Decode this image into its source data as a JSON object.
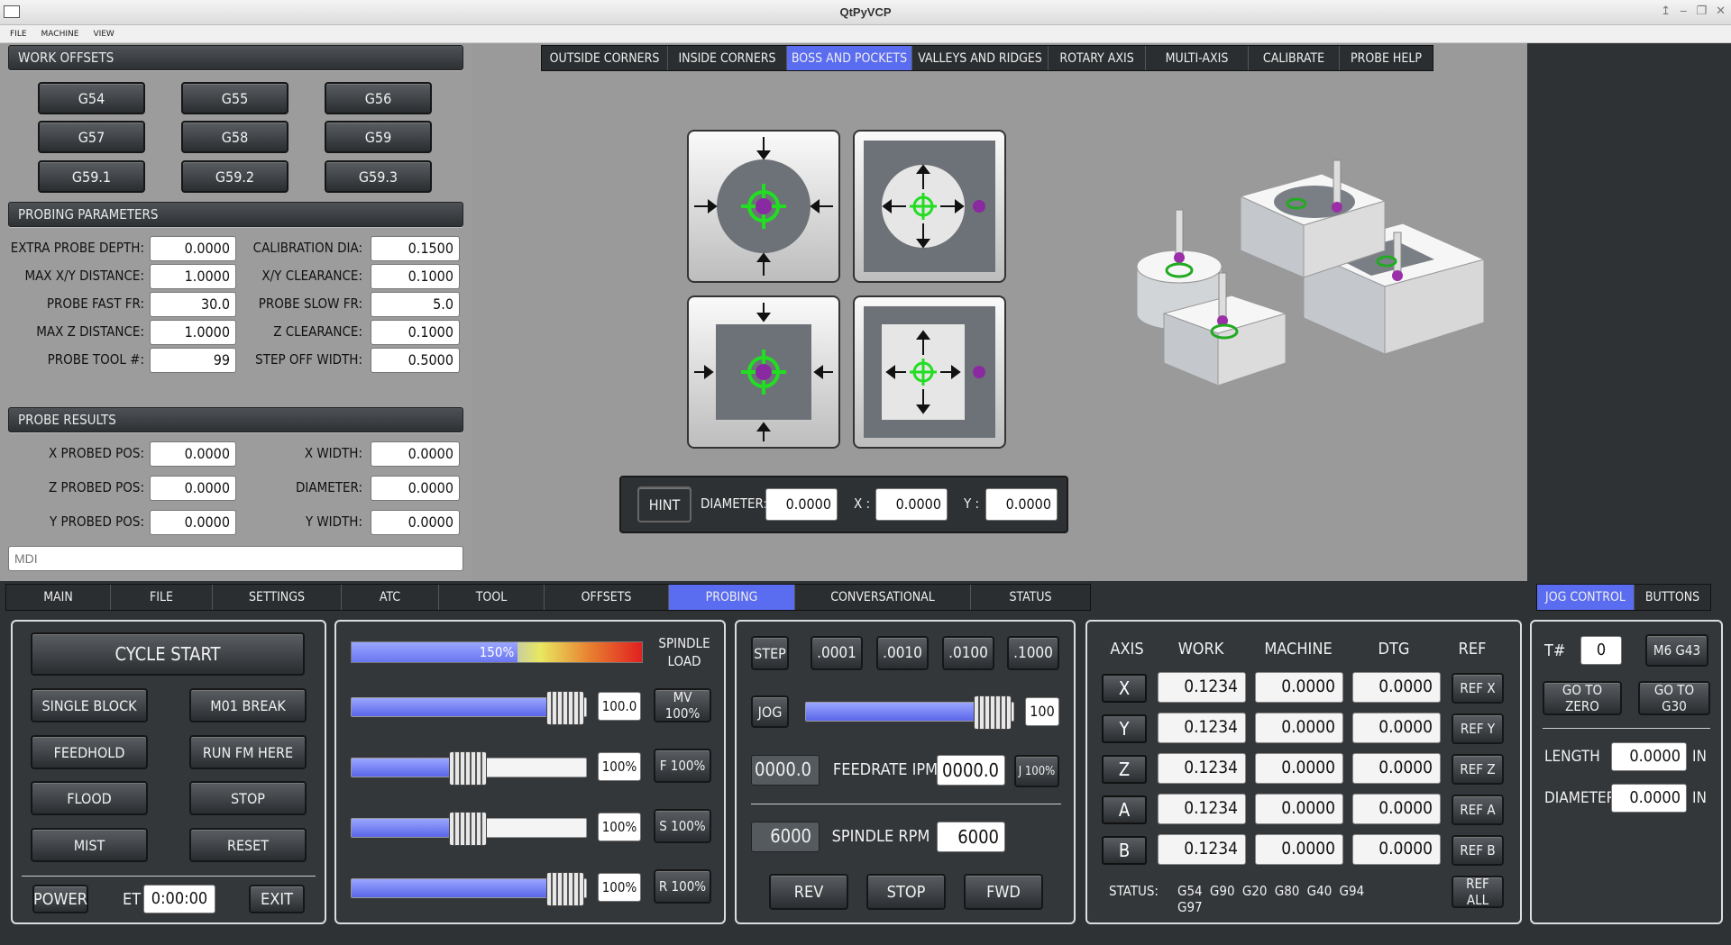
{
  "window": {
    "title": "QtPyVCP",
    "controls": [
      "↥",
      "‒",
      "❐",
      "✕"
    ]
  },
  "menu": [
    "FILE",
    "MACHINE",
    "VIEW"
  ],
  "work_offsets": {
    "header": "WORK OFFSETS",
    "buttons": [
      "G54",
      "G55",
      "G56",
      "G57",
      "G58",
      "G59",
      "G59.1",
      "G59.2",
      "G59.3"
    ]
  },
  "probing_params": {
    "header": "PROBING PARAMETERS",
    "rows": [
      {
        "l1": "EXTRA PROBE DEPTH:",
        "v1": "0.0000",
        "l2": "CALIBRATION DIA:",
        "v2": "0.1500"
      },
      {
        "l1": "MAX X/Y DISTANCE:",
        "v1": "1.0000",
        "l2": "X/Y CLEARANCE:",
        "v2": "0.1000"
      },
      {
        "l1": "PROBE FAST FR:",
        "v1": "30.0",
        "l2": "PROBE SLOW FR:",
        "v2": "5.0"
      },
      {
        "l1": "MAX Z DISTANCE:",
        "v1": "1.0000",
        "l2": "Z CLEARANCE:",
        "v2": "0.1000"
      },
      {
        "l1": "PROBE TOOL #:",
        "v1": "99",
        "l2": "STEP OFF WIDTH:",
        "v2": "0.5000"
      }
    ]
  },
  "probe_results": {
    "header": "PROBE RESULTS",
    "rows": [
      {
        "l1": "X PROBED POS:",
        "v1": "0.0000",
        "l2": "X WIDTH:",
        "v2": "0.0000"
      },
      {
        "l1": "Z PROBED POS:",
        "v1": "0.0000",
        "l2": "DIAMETER:",
        "v2": "0.0000"
      },
      {
        "l1": "Y PROBED POS:",
        "v1": "0.0000",
        "l2": "Y WIDTH:",
        "v2": "0.0000"
      }
    ]
  },
  "mdi": {
    "placeholder": "MDI"
  },
  "probe_tabs": [
    "OUTSIDE CORNERS",
    "INSIDE CORNERS",
    "BOSS AND POCKETS",
    "VALLEYS AND RIDGES",
    "ROTARY AXIS",
    "MULTI-AXIS",
    "CALIBRATE",
    "PROBE HELP"
  ],
  "probe_tabs_active": "BOSS AND POCKETS",
  "hint_bar": {
    "hint": "HINT",
    "diameter_label": "DIAMETER:",
    "diameter": "0.0000",
    "x_label": "X :",
    "x": "0.0000",
    "y_label": "Y :",
    "y": "0.0000"
  },
  "main_tabs": [
    "MAIN",
    "FILE",
    "SETTINGS",
    "ATC",
    "TOOL",
    "OFFSETS",
    "PROBING",
    "CONVERSATIONAL",
    "STATUS"
  ],
  "main_tabs_active": "PROBING",
  "right_tabs": [
    "JOG CONTROL",
    "BUTTONS"
  ],
  "right_tabs_active": "JOG CONTROL",
  "cycle": {
    "cycle_start": "CYCLE START",
    "single_block": "SINGLE BLOCK",
    "m01_break": "M01 BREAK",
    "feedhold": "FEEDHOLD",
    "run_fm_here": "RUN FM HERE",
    "flood": "FLOOD",
    "stop": "STOP",
    "mist": "MIST",
    "reset": "RESET",
    "power": "POWER",
    "et_label": "ET",
    "et_value": "0:00:00",
    "exit": "EXIT"
  },
  "overrides": {
    "spindle_load_label": "SPINDLE LOAD",
    "spindle_load_text": "150%",
    "spindle_load_fraction": 0.57,
    "rows": [
      {
        "value": "100.0",
        "button": "MV 100%",
        "level": 1.0
      },
      {
        "value": "100%",
        "button": "F 100%",
        "level": 0.5
      },
      {
        "value": "100%",
        "button": "S 100%",
        "level": 0.5
      },
      {
        "value": "100%",
        "button": "R 100%",
        "level": 1.0
      }
    ]
  },
  "jog": {
    "step": "STEP",
    "increments": [
      ".0001",
      ".0010",
      ".0100",
      ".1000"
    ],
    "jog": "JOG",
    "jog_value": "100",
    "jog_level": 1.0,
    "feed_actual": "0000.0",
    "feedrate_label": "FEEDRATE IPM",
    "feed_set": "0000.0",
    "j100": "J 100%",
    "rpm_actual": "6000",
    "spindle_rpm_label": "SPINDLE RPM",
    "rpm_set": "6000",
    "rev": "REV",
    "stop": "STOP",
    "fwd": "FWD"
  },
  "dro": {
    "headers": [
      "AXIS",
      "WORK",
      "MACHINE",
      "DTG",
      "REF"
    ],
    "rows": [
      {
        "axis": "X",
        "work": "0.1234",
        "machine": "0.0000",
        "dtg": "0.0000",
        "ref": "REF X"
      },
      {
        "axis": "Y",
        "work": "0.1234",
        "machine": "0.0000",
        "dtg": "0.0000",
        "ref": "REF Y"
      },
      {
        "axis": "Z",
        "work": "0.1234",
        "machine": "0.0000",
        "dtg": "0.0000",
        "ref": "REF Z"
      },
      {
        "axis": "A",
        "work": "0.1234",
        "machine": "0.0000",
        "dtg": "0.0000",
        "ref": "REF A"
      },
      {
        "axis": "B",
        "work": "0.1234",
        "machine": "0.0000",
        "dtg": "0.0000",
        "ref": "REF B"
      }
    ],
    "status_label": "STATUS:",
    "status_codes": "G54 G90 G20 G80 G40 G94 G97",
    "ref_all": "REF ALL"
  },
  "tool": {
    "t_label": "T#",
    "t_value": "0",
    "m6g43": "M6 G43",
    "go_zero": "GO TO ZERO",
    "go_g30": "GO TO G30",
    "length_label": "LENGTH",
    "length": "0.0000",
    "diameter_label": "DIAMETER",
    "diameter": "0.0000",
    "unit": "IN"
  },
  "colors": {
    "accent": "#5a6cf0",
    "probe_green": "#22dd22",
    "probe_ball": "#9a2fa8"
  }
}
